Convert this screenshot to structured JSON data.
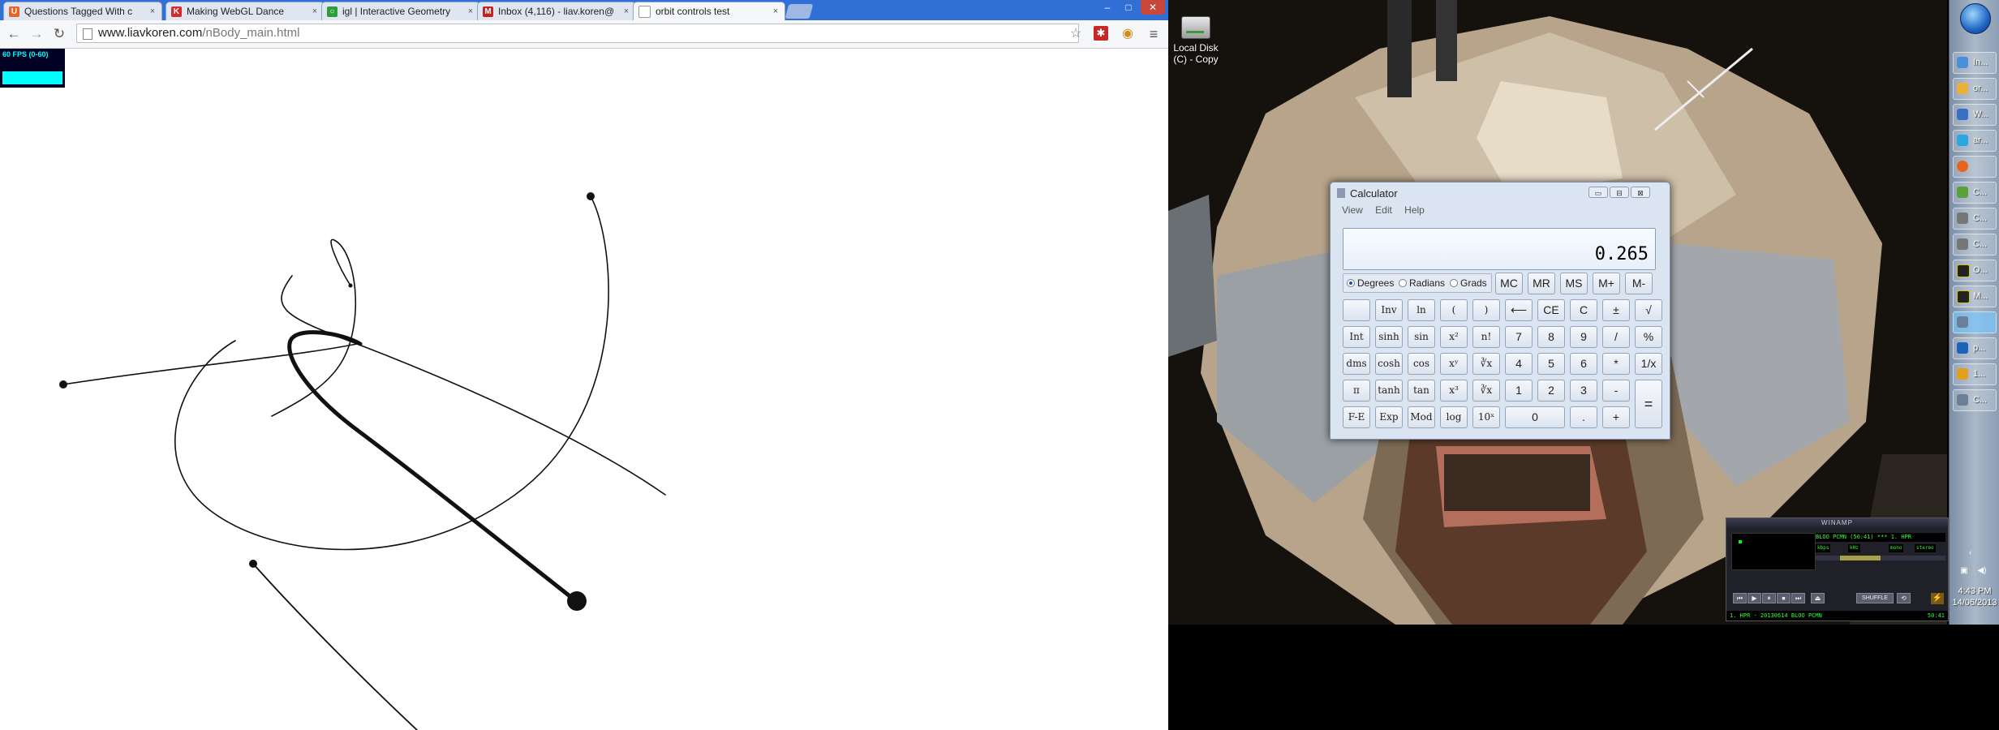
{
  "browser": {
    "tabs": [
      {
        "label": "Questions Tagged With c",
        "favicon_color": "#e6662a",
        "favicon_glyph": "U",
        "active": false
      },
      {
        "label": "Making WebGL Dance",
        "favicon_color": "#d42b2b",
        "favicon_glyph": "K",
        "active": false
      },
      {
        "label": "igl | Interactive Geometry",
        "favicon_color": "#2e9e3c",
        "favicon_glyph": "○",
        "active": false
      },
      {
        "label": "Inbox (4,116) - liav.koren@",
        "favicon_color": "#c5221f",
        "favicon_glyph": "M",
        "active": false
      },
      {
        "label": "orbit controls test",
        "favicon_color": "#ffffff",
        "favicon_glyph": "",
        "active": true
      }
    ],
    "close_glyph": "×",
    "window_controls": {
      "minimize": "–",
      "maximize": "□",
      "close": "✕"
    },
    "nav": {
      "back": "←",
      "forward": "→",
      "reload": "↻"
    },
    "url": {
      "host": "www.liavkoren.com",
      "path": "/nBody_main.html"
    },
    "toolbar_icons": {
      "bookmark": "☆",
      "extension_red": "✱",
      "extension_cookie": "◉",
      "menu": "≡"
    },
    "stats_overlay": {
      "text": "60 FPS (0-60)",
      "color": "#00ffff"
    }
  },
  "desktop": {
    "icon": {
      "label_line1": "Local Disk",
      "label_line2": "(C) - Copy"
    },
    "calculator": {
      "title": "Calculator",
      "window_buttons": {
        "minimize": "▭",
        "maximize": "⊟",
        "close": "⊠"
      },
      "menu": [
        "View",
        "Edit",
        "Help"
      ],
      "display": "0.265",
      "angle_modes": [
        {
          "label": "Degrees",
          "selected": true
        },
        {
          "label": "Radians",
          "selected": false
        },
        {
          "label": "Grads",
          "selected": false
        }
      ],
      "keys": [
        [
          "MC",
          "MR",
          "MS",
          "M+",
          "M-"
        ],
        [
          "",
          "Inv",
          "ln",
          "(",
          ")",
          "⟵",
          "CE",
          "C",
          "±",
          "√"
        ],
        [
          "Int",
          "sinh",
          "sin",
          "x²",
          "n!",
          "7",
          "8",
          "9",
          "/",
          "%"
        ],
        [
          "dms",
          "cosh",
          "cos",
          "xʸ",
          "∛x",
          "4",
          "5",
          "6",
          "*",
          "1/x"
        ],
        [
          "π",
          "tanh",
          "tan",
          "x³",
          "∛x",
          "1",
          "2",
          "3",
          "-",
          "="
        ],
        [
          "F-E",
          "Exp",
          "Mod",
          "log",
          "10ˣ",
          "0",
          ".",
          "+"
        ]
      ]
    },
    "winamp": {
      "title": "WINAMP",
      "marquee": "BLOO PCMN (50:41) *** 1. HPR",
      "time": "",
      "kbps": "kbps",
      "khz": "kHz",
      "mono": "mono",
      "stereo": "stereo",
      "controls": [
        "⏮",
        "▶",
        "⏸",
        "⏹",
        "⏭",
        "⏏"
      ],
      "shuffle": "SHUFFLE",
      "repeat": "⟲",
      "playlist": "1. HPR - 20130614 BLOO PCMN",
      "playlist_time": "50:41"
    },
    "taskbar": {
      "items": [
        {
          "label": "In...",
          "color": "#4a90d9",
          "active": false
        },
        {
          "label": "or...",
          "color": "#e8b23a",
          "active": false
        },
        {
          "label": "W...",
          "color": "#3b6fc4",
          "active": false
        },
        {
          "label": "ar...",
          "color": "#2aa7e0",
          "active": false
        },
        {
          "label": "",
          "color": "#e8641e",
          "active": false
        },
        {
          "label": "C...",
          "color": "#5aa03c",
          "active": false
        },
        {
          "label": "C...",
          "color": "#777777",
          "active": false
        },
        {
          "label": "C...",
          "color": "#777777",
          "active": false
        },
        {
          "label": "O...",
          "color": "#222222",
          "active": false
        },
        {
          "label": "M...",
          "color": "#222222",
          "active": false
        },
        {
          "label": "",
          "color": "#6a7f98",
          "active": true
        },
        {
          "label": "p...",
          "color": "#1d63b8",
          "active": false
        },
        {
          "label": "1...",
          "color": "#e0a020",
          "active": false
        },
        {
          "label": "C...",
          "color": "#6a7f98",
          "active": false
        }
      ],
      "tray": {
        "arrow": "‹",
        "time": "4:43 PM",
        "date": "14/06/2013",
        "icon_network": "▣",
        "icon_volume": "◀)"
      }
    }
  }
}
